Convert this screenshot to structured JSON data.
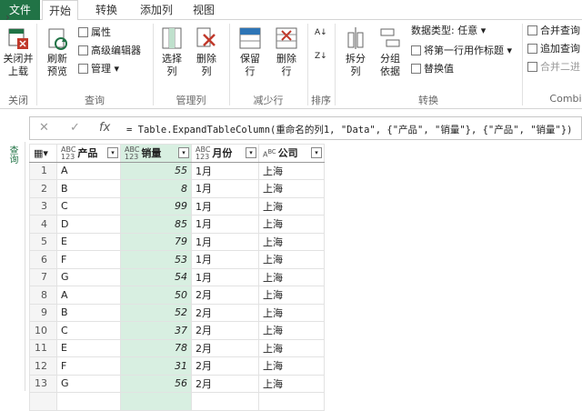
{
  "tabs": {
    "file": "文件",
    "home": "开始",
    "transform": "转换",
    "add_column": "添加列",
    "view": "视图"
  },
  "ribbon": {
    "close_load": "关闭并\n上载",
    "close_load_l1": "关闭并",
    "close_load_l2": "上载",
    "refresh_l1": "刷新",
    "refresh_l2": "预览",
    "properties": "属性",
    "advanced_editor": "高级编辑器",
    "manage": "管理",
    "select_col_l1": "选择",
    "select_col_l2": "列",
    "remove_col_l1": "删除",
    "remove_col_l2": "列",
    "keep_rows_l1": "保留",
    "keep_rows_l2": "行",
    "remove_rows_l1": "删除",
    "remove_rows_l2": "行",
    "split_l1": "拆分",
    "split_l2": "列",
    "group_l1": "分组",
    "group_l2": "依据",
    "data_type": "数据类型: 任意",
    "first_row_header": "将第一行用作标题",
    "replace_values": "替换值",
    "merge_queries": "合并查询",
    "append_queries": "追加查询",
    "combine_files": "合并二进",
    "groups": {
      "close": "关闭",
      "query": "查询",
      "manage_cols": "管理列",
      "reduce_rows": "减少行",
      "sort": "排序",
      "transform": "转换",
      "combine": "Combi"
    }
  },
  "formula": "= Table.ExpandTableColumn(重命名的列1, \"Data\", {\"产品\", \"销量\"}, {\"产品\", \"销量\"})",
  "queries_label": "查询",
  "columns": [
    {
      "type": "ABC\n123",
      "t1": "ABC",
      "t2": "123",
      "name": "产品"
    },
    {
      "type": "ABC\n123",
      "t1": "ABC",
      "t2": "123",
      "name": "销量"
    },
    {
      "type": "ABC\n123",
      "t1": "ABC",
      "t2": "123",
      "name": "月份"
    },
    {
      "type": "ABC",
      "t1": "A",
      "t2": "BC",
      "name": "公司"
    }
  ],
  "rows": [
    [
      "1",
      "A",
      "55",
      "1月",
      "上海"
    ],
    [
      "2",
      "B",
      "8",
      "1月",
      "上海"
    ],
    [
      "3",
      "C",
      "99",
      "1月",
      "上海"
    ],
    [
      "4",
      "D",
      "85",
      "1月",
      "上海"
    ],
    [
      "5",
      "E",
      "79",
      "1月",
      "上海"
    ],
    [
      "6",
      "F",
      "53",
      "1月",
      "上海"
    ],
    [
      "7",
      "G",
      "54",
      "1月",
      "上海"
    ],
    [
      "8",
      "A",
      "50",
      "2月",
      "上海"
    ],
    [
      "9",
      "B",
      "52",
      "2月",
      "上海"
    ],
    [
      "10",
      "C",
      "37",
      "2月",
      "上海"
    ],
    [
      "11",
      "E",
      "78",
      "2月",
      "上海"
    ],
    [
      "12",
      "F",
      "31",
      "2月",
      "上海"
    ],
    [
      "13",
      "G",
      "56",
      "2月",
      "上海"
    ],
    [
      "",
      "",
      "",
      "",
      ""
    ]
  ]
}
